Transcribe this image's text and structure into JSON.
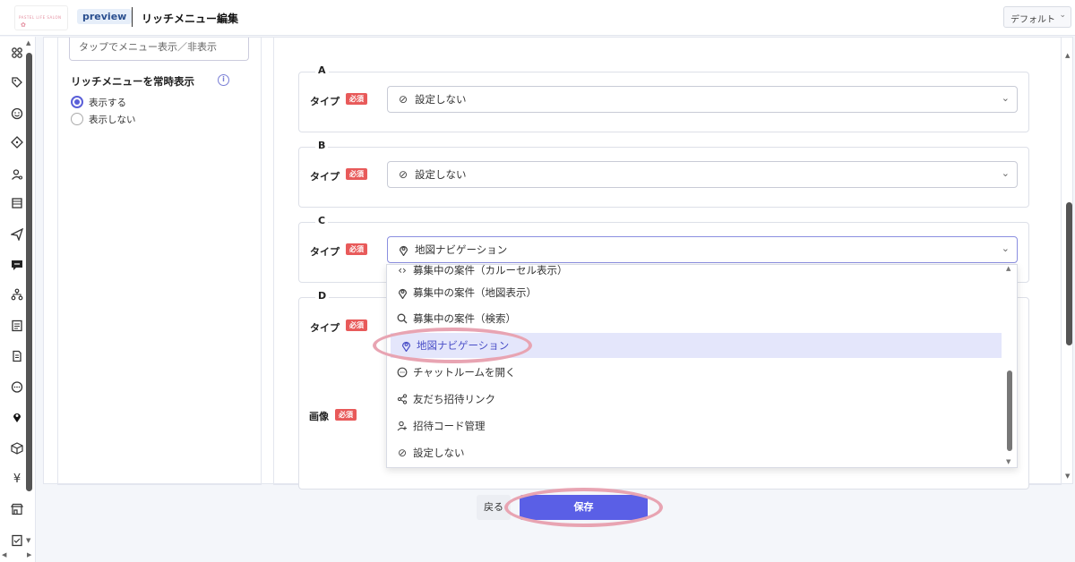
{
  "header": {
    "logo_text": "PASTEL LIFE SALON",
    "preview_badge": "preview",
    "title": "リッチメニュー編集",
    "default_select": "デフォルト"
  },
  "sidebar": {
    "icons": [
      "users-icon",
      "tag-icon",
      "smile-icon",
      "ticket-icon",
      "user-search-icon",
      "list-icon",
      "send-icon",
      "chat-bubble-icon",
      "flow-icon",
      "document-icon",
      "file-edit-icon",
      "message-icon",
      "map-pin-icon",
      "box-icon",
      "yen-icon",
      "store-icon",
      "checklist-icon"
    ]
  },
  "left_panel": {
    "old_input_text": "タップでメニュー表示／非表示",
    "always_show_label": "リッチメニューを常時表示",
    "radio_show": "表示する",
    "radio_hide": "表示しない"
  },
  "areas": [
    {
      "letter": "A",
      "type_label": "タイプ",
      "required": "必須",
      "value": "設定しない"
    },
    {
      "letter": "B",
      "type_label": "タイプ",
      "required": "必須",
      "value": "設定しない"
    },
    {
      "letter": "C",
      "type_label": "タイプ",
      "required": "必須",
      "value": "地図ナビゲーション"
    },
    {
      "letter": "D",
      "type_label": "タイプ",
      "required": "必須",
      "image_label": "画像",
      "image_required": "必須"
    }
  ],
  "dropdown": {
    "options": [
      {
        "label": "募集中の案件（カルーセル表示）",
        "icon": "code-icon"
      },
      {
        "label": "募集中の案件（地図表示）",
        "icon": "map-pin-icon"
      },
      {
        "label": "募集中の案件（検索）",
        "icon": "search-icon"
      },
      {
        "label": "地図ナビゲーション",
        "icon": "map-pin-icon",
        "selected": true
      },
      {
        "label": "チャットルームを開く",
        "icon": "chat-icon"
      },
      {
        "label": "友だち招待リンク",
        "icon": "share-icon"
      },
      {
        "label": "招待コード管理",
        "icon": "user-plus-icon"
      },
      {
        "label": "設定しない",
        "icon": "ban-icon"
      }
    ]
  },
  "footer": {
    "back_label": "戻る",
    "save_label": "保存"
  },
  "colors": {
    "accent": "#5a5fe6",
    "required_badge": "#e85a5a",
    "highlight_ring": "#e8a4b2",
    "selected_option_bg": "#e4e6fb"
  }
}
